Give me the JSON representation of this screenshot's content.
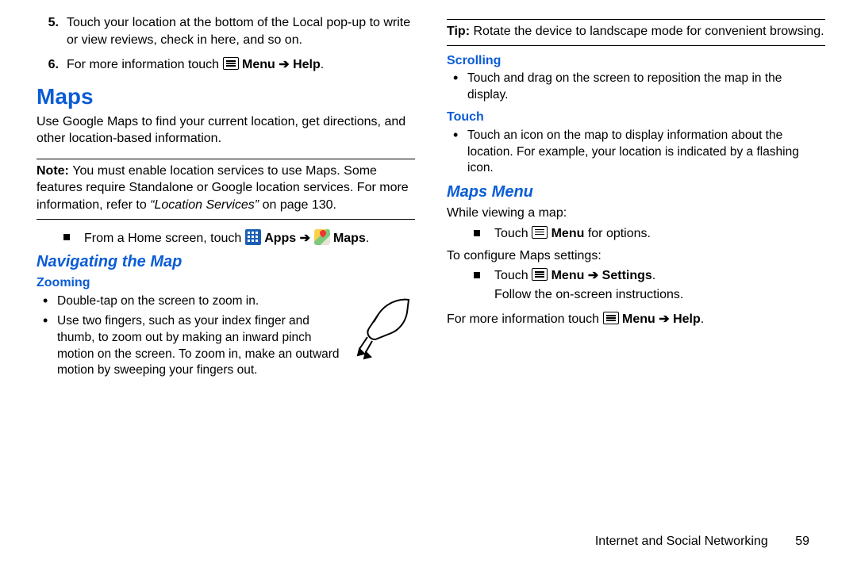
{
  "left": {
    "item5_num": "5.",
    "item5_text": "Touch your location at the bottom of the Local pop-up to write or view reviews, check in here, and so on.",
    "item6_num": "6.",
    "item6_pre": "For more information touch ",
    "item6_menu": "Menu",
    "item6_arrow": " ➔ ",
    "item6_help": "Help",
    "item6_period": ".",
    "maps_heading": "Maps",
    "maps_desc": "Use Google Maps to find your current location, get directions, and other location-based information.",
    "note_label": "Note: ",
    "note_text_a": "You must enable location services to use Maps. Some features require Standalone or Google location services. For more information, refer to ",
    "note_ref": "“Location Services”",
    "note_text_b": " on page 130.",
    "home_pre": "From a Home screen, touch ",
    "home_apps": "Apps",
    "home_arrow": " ➔ ",
    "home_maps": "Maps",
    "home_period": ".",
    "nav_heading": "Navigating the Map",
    "zoom_heading": "Zooming",
    "zoom_b1": "Double-tap on the screen to zoom in.",
    "zoom_b2": "Use two fingers, such as your index finger and thumb, to zoom out by making an inward pinch motion on the screen. To zoom in, make an outward motion by sweeping your fingers out."
  },
  "right": {
    "tip_label": "Tip: ",
    "tip_text": "Rotate the device to landscape mode for convenient browsing.",
    "scroll_heading": "Scrolling",
    "scroll_b1": "Touch and drag on the screen to reposition the map in the display.",
    "touch_heading": "Touch",
    "touch_b1": "Touch an icon on the map to display information about the location. For example, your location is indicated by a flashing icon.",
    "menu_heading": "Maps Menu",
    "while_text": "While viewing a map:",
    "sq1_pre": "Touch ",
    "sq1_menu": "Menu",
    "sq1_post": " for options.",
    "configure_text": "To configure Maps settings:",
    "sq2_pre": "Touch ",
    "sq2_menu": "Menu",
    "sq2_arrow": " ➔ ",
    "sq2_settings": "Settings",
    "sq2_period": ".",
    "sq2_line2": "Follow the on-screen instructions.",
    "more_pre": "For more information touch ",
    "more_menu": "Menu",
    "more_arrow": " ➔ ",
    "more_help": "Help",
    "more_period": "."
  },
  "footer": {
    "chapter": "Internet and Social Networking",
    "page": "59"
  }
}
